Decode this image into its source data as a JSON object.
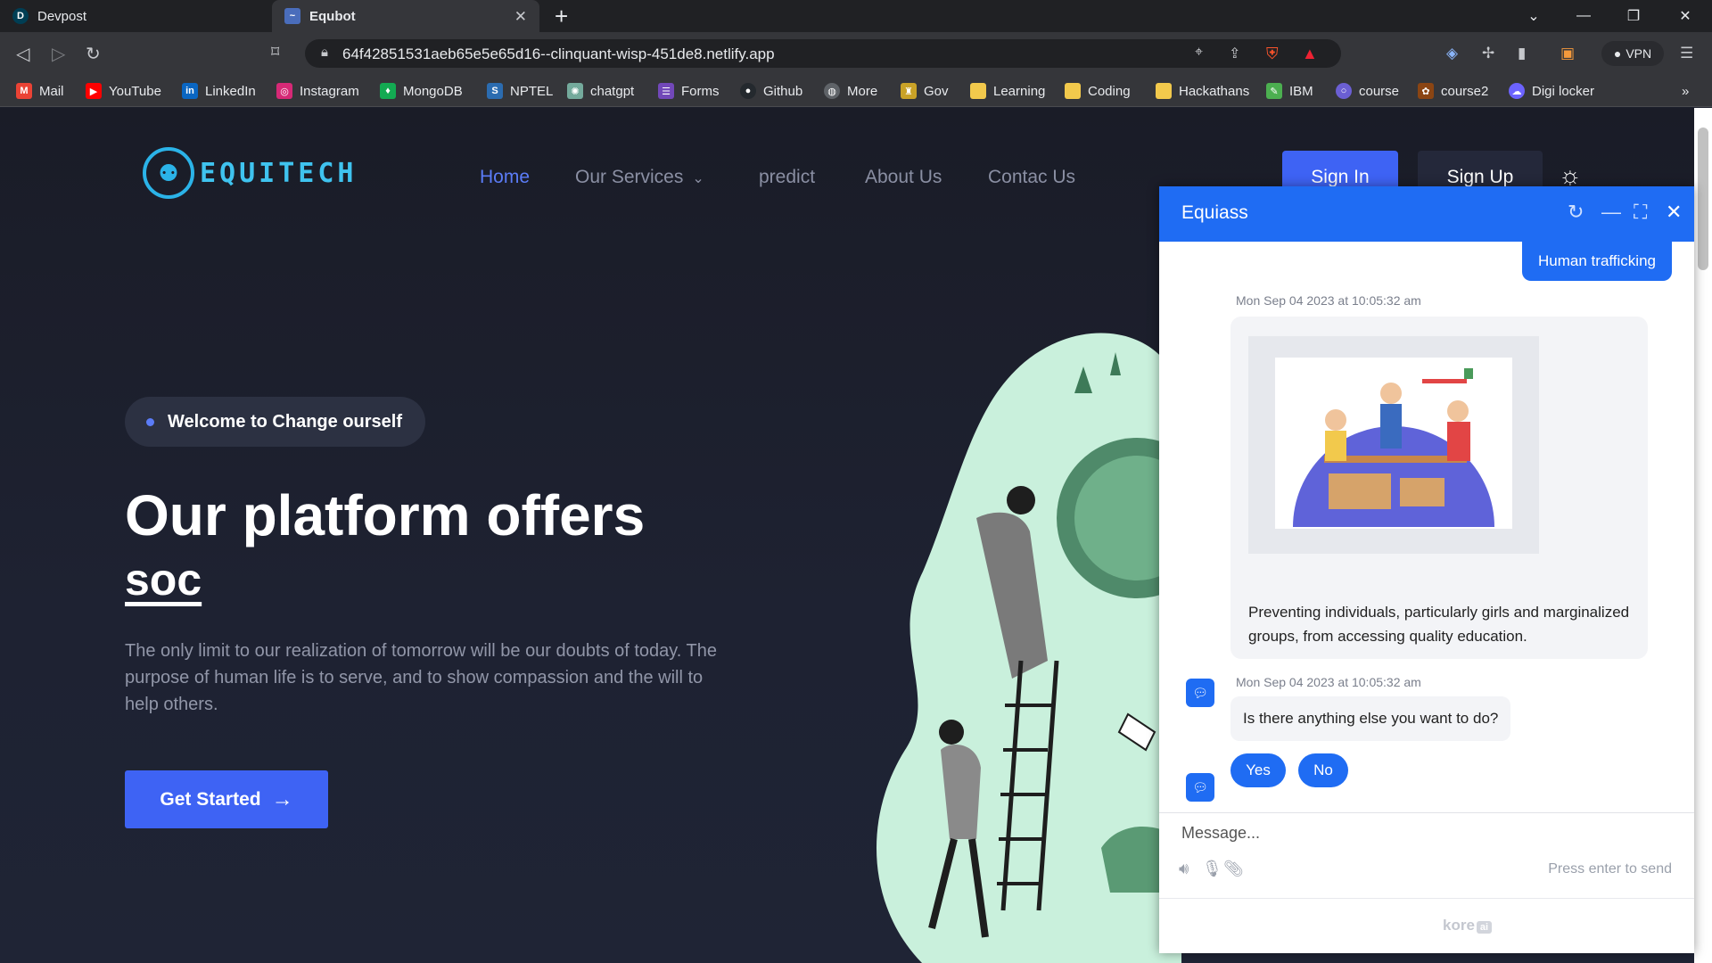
{
  "browser": {
    "tabs": [
      {
        "label": "Devpost",
        "favicon": "D",
        "favicon_color": "#003e54"
      },
      {
        "label": "Equbot",
        "favicon": "~",
        "favicon_color": "#4a6dbb"
      }
    ],
    "url": "64f42851531aeb65e5e65d16--clinquant-wisp-451de8.netlify.app",
    "vpn_label": "VPN",
    "bookmarks": [
      {
        "label": "Mail",
        "icon": "M",
        "color": "#ea4335"
      },
      {
        "label": "YouTube",
        "icon": "▶",
        "color": "#ff0000"
      },
      {
        "label": "LinkedIn",
        "icon": "in",
        "color": "#0a66c2"
      },
      {
        "label": "Instagram",
        "icon": "◎",
        "color": "#d62976"
      },
      {
        "label": "MongoDB",
        "icon": "♦",
        "color": "#13aa52"
      },
      {
        "label": "NPTEL",
        "icon": "S",
        "color": "#2b6cb0"
      },
      {
        "label": "chatgpt",
        "icon": "✺",
        "color": "#74aa9c"
      },
      {
        "label": "Forms",
        "icon": "☰",
        "color": "#7248b9"
      },
      {
        "label": "Github",
        "icon": "●",
        "color": "#24292e"
      },
      {
        "label": "More",
        "icon": "◍",
        "color": "#5f6368"
      },
      {
        "label": "Gov",
        "icon": "♜",
        "color": "#c9a227"
      },
      {
        "label": "Learning",
        "icon": "",
        "color": "#f2c94c"
      },
      {
        "label": "Coding",
        "icon": "",
        "color": "#f2c94c"
      },
      {
        "label": "Hackathans",
        "icon": "",
        "color": "#f2c94c"
      },
      {
        "label": "IBM",
        "icon": "✎",
        "color": "#4caf50"
      },
      {
        "label": "course",
        "icon": "○",
        "color": "#6b5fd3"
      },
      {
        "label": "course2",
        "icon": "✿",
        "color": "#8b4513"
      },
      {
        "label": "Digi locker",
        "icon": "☁",
        "color": "#6c63ff"
      }
    ]
  },
  "site": {
    "logo_text": "EQUITECH",
    "nav": [
      "Home",
      "Our Services",
      "predict",
      "About Us",
      "Contac Us"
    ],
    "sign_in": "Sign In",
    "sign_up": "Sign Up",
    "welcome_badge": "Welcome to Change ourself",
    "hero_title": "Our platform offers",
    "hero_highlight": "soc",
    "hero_description": "The only limit to our realization of tomorrow will be our doubts of today. The purpose of human life is to serve, and to show compassion and the will to help others.",
    "cta": "Get Started"
  },
  "chat": {
    "title": "Equiass",
    "user_message": "Human trafficking",
    "timestamp_1": "Mon Sep 04 2023 at 10:05:32 am",
    "card_text": "Preventing individuals, particularly girls and marginalized groups, from accessing quality education.",
    "timestamp_2": "Mon Sep 04 2023 at 10:05:32 am",
    "bot_question": "Is there anything else you want to do?",
    "quick_replies": [
      "Yes",
      "No"
    ],
    "input_placeholder": "Message...",
    "send_hint": "Press enter to send",
    "powered_by": "kore",
    "powered_by_suffix": "ai"
  },
  "colors": {
    "accent": "#3e63f4",
    "chat_header": "#1f6cf3",
    "page_bg": "#1c1f2b"
  }
}
